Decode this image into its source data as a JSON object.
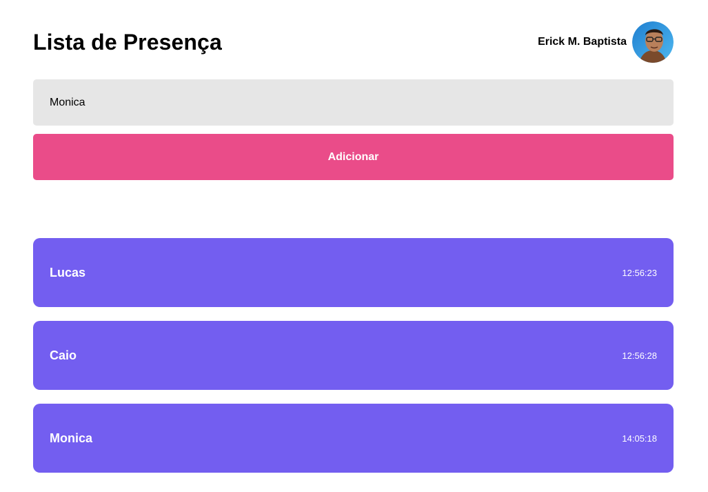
{
  "header": {
    "title": "Lista de Presença",
    "user_name": "Erick M. Baptista",
    "avatar_icon": "user-avatar"
  },
  "form": {
    "input_value": "Monica",
    "button_label": "Adicionar"
  },
  "students": [
    {
      "name": "Lucas",
      "time": "12:56:23"
    },
    {
      "name": "Caio",
      "time": "12:56:28"
    },
    {
      "name": "Monica",
      "time": "14:05:18"
    }
  ],
  "colors": {
    "accent_button": "#ea4c89",
    "card_background": "#735ef0",
    "input_background": "#e6e6e6"
  }
}
